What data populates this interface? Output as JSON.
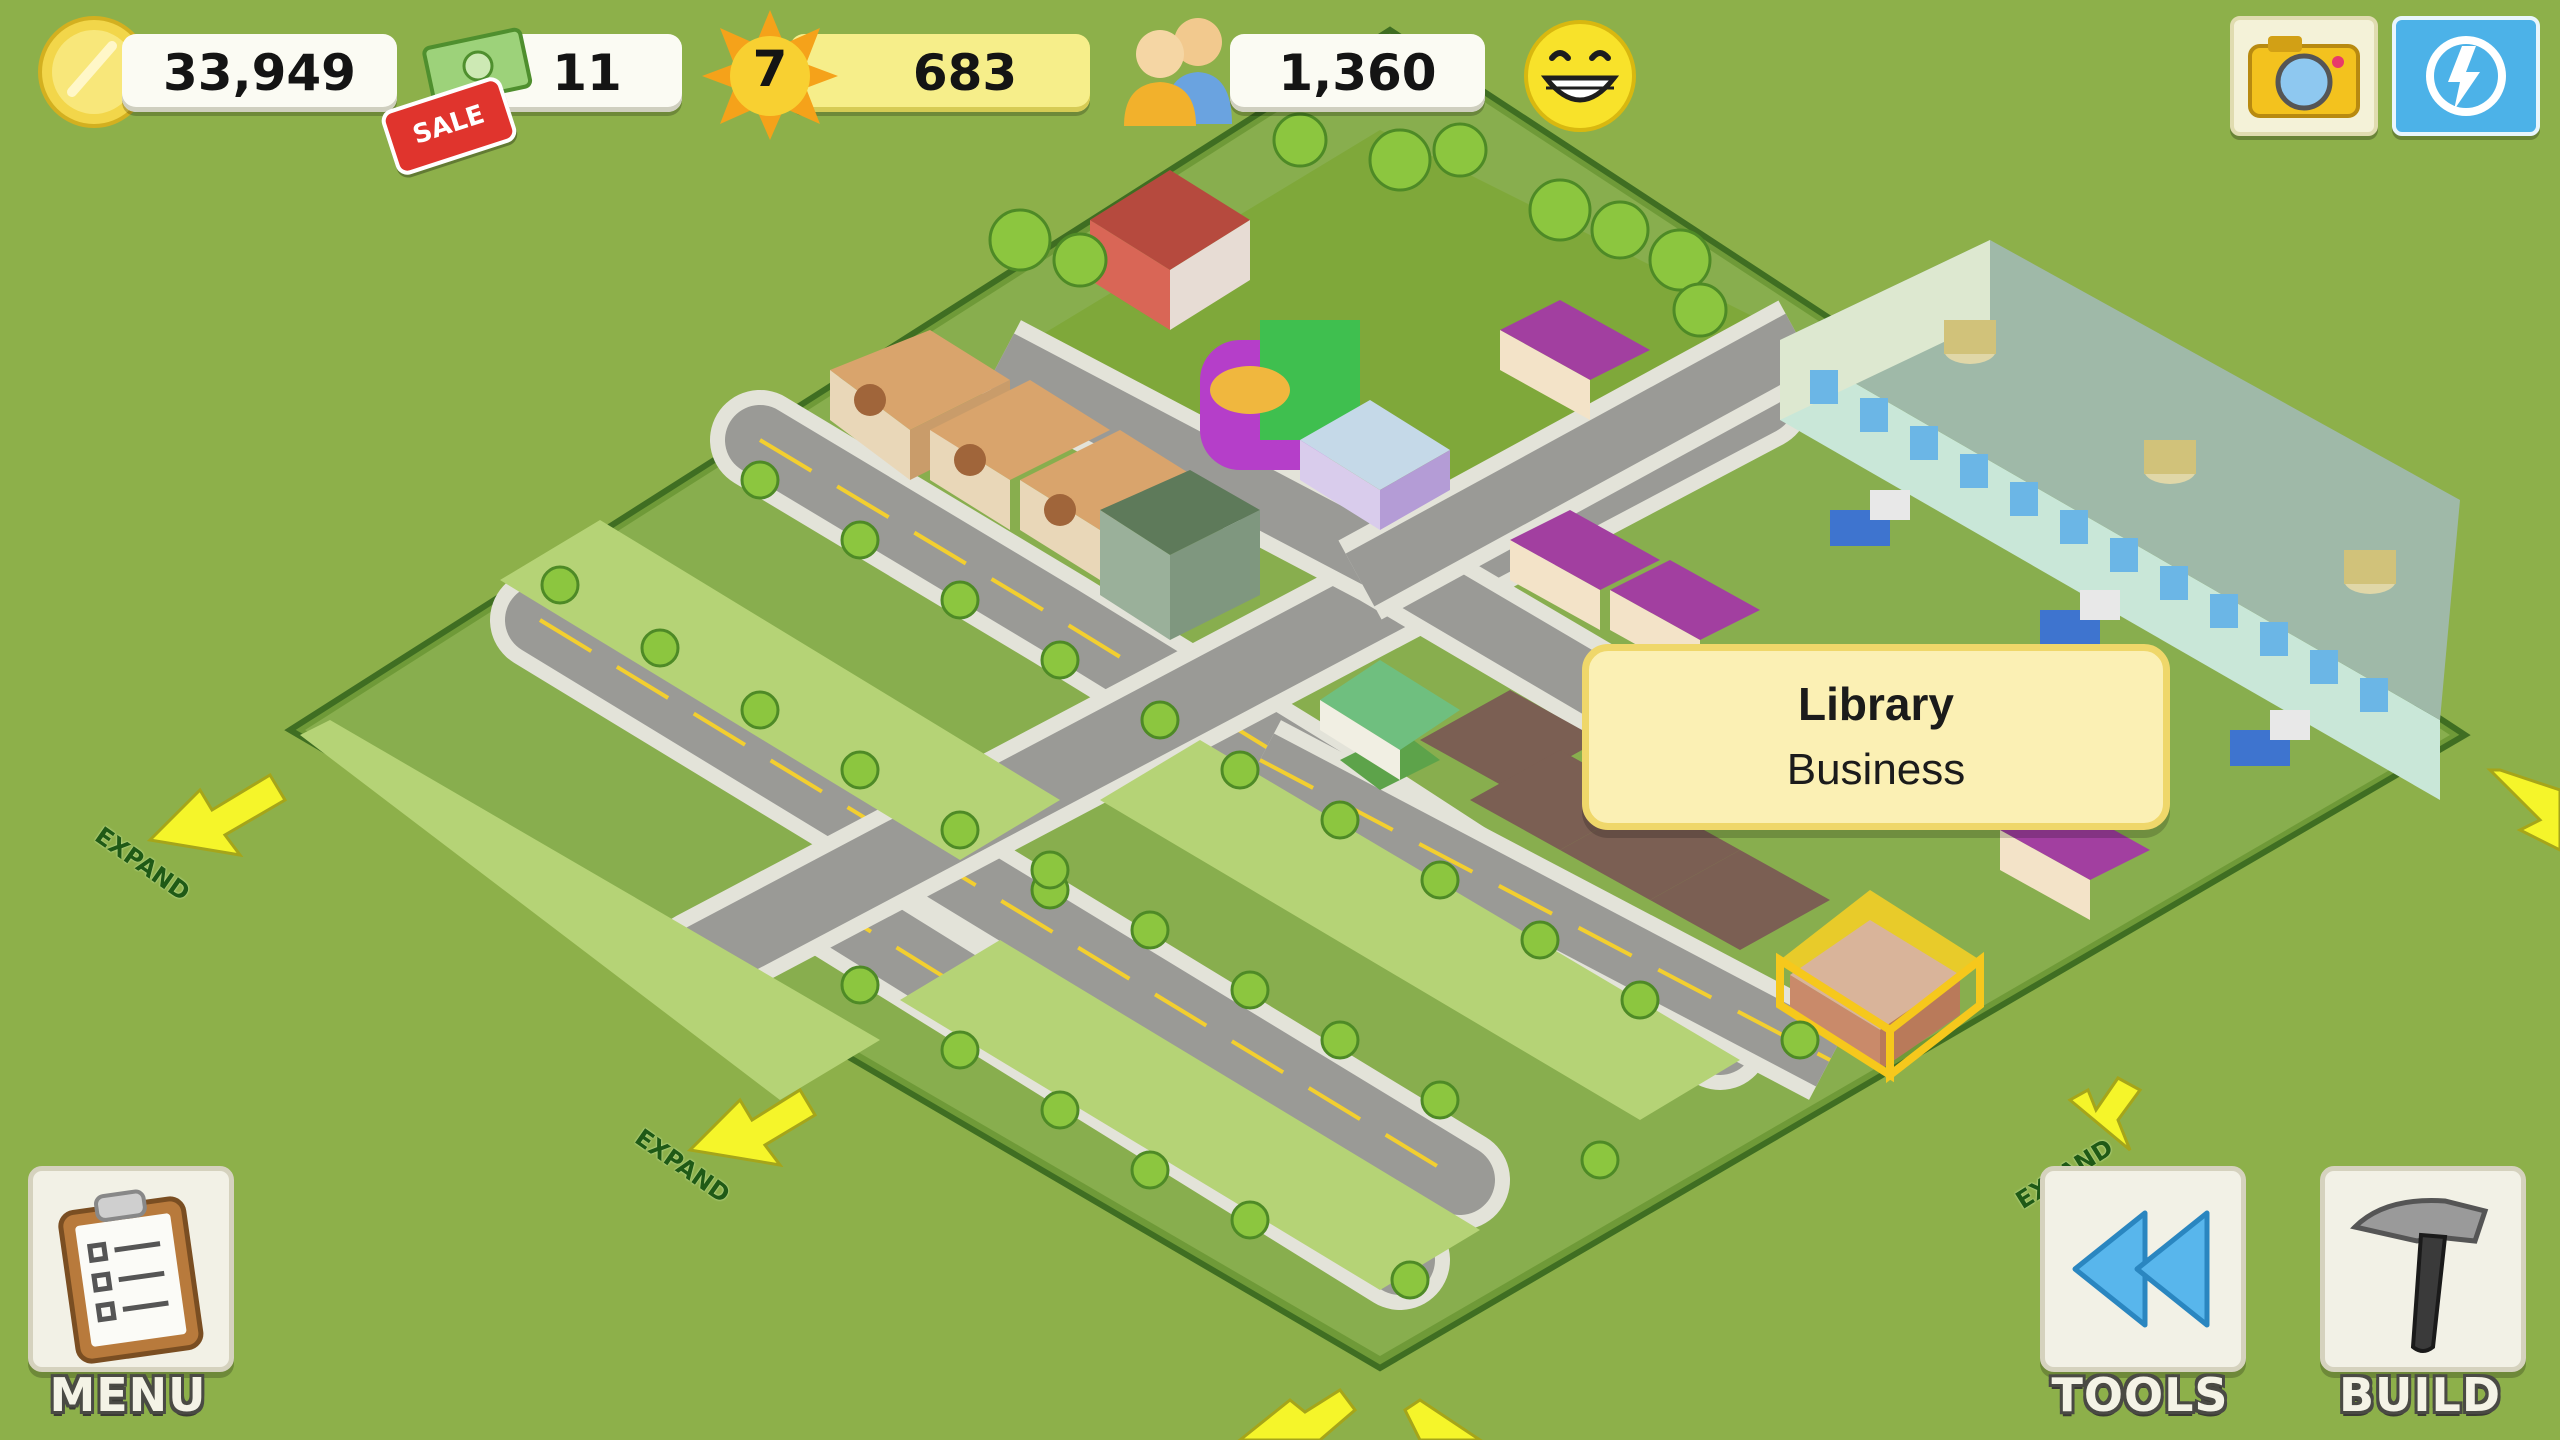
{
  "hud": {
    "coins": "33,949",
    "cash": "11",
    "sale_badge": "SALE",
    "level": "7",
    "xp": "683",
    "population": "1,360",
    "happiness_icon": "smiley-face-icon",
    "camera_icon": "camera-icon",
    "social_icon": "social-share-icon"
  },
  "tooltip": {
    "title": "Library",
    "subtitle": "Business"
  },
  "expand_labels": [
    "EXPAND",
    "EXPAND",
    "EXPAND"
  ],
  "buttons": {
    "menu": "MENU",
    "tools": "TOOLS",
    "build": "BUILD"
  },
  "colors": {
    "ground": "#8db04a",
    "lot": "#b5d376",
    "road": "#9a9a96",
    "sidewalk": "#e2e2da",
    "lane_marking": "#f3cf2f",
    "arrow": "#f5f52a",
    "selection": "#f6c81c"
  }
}
